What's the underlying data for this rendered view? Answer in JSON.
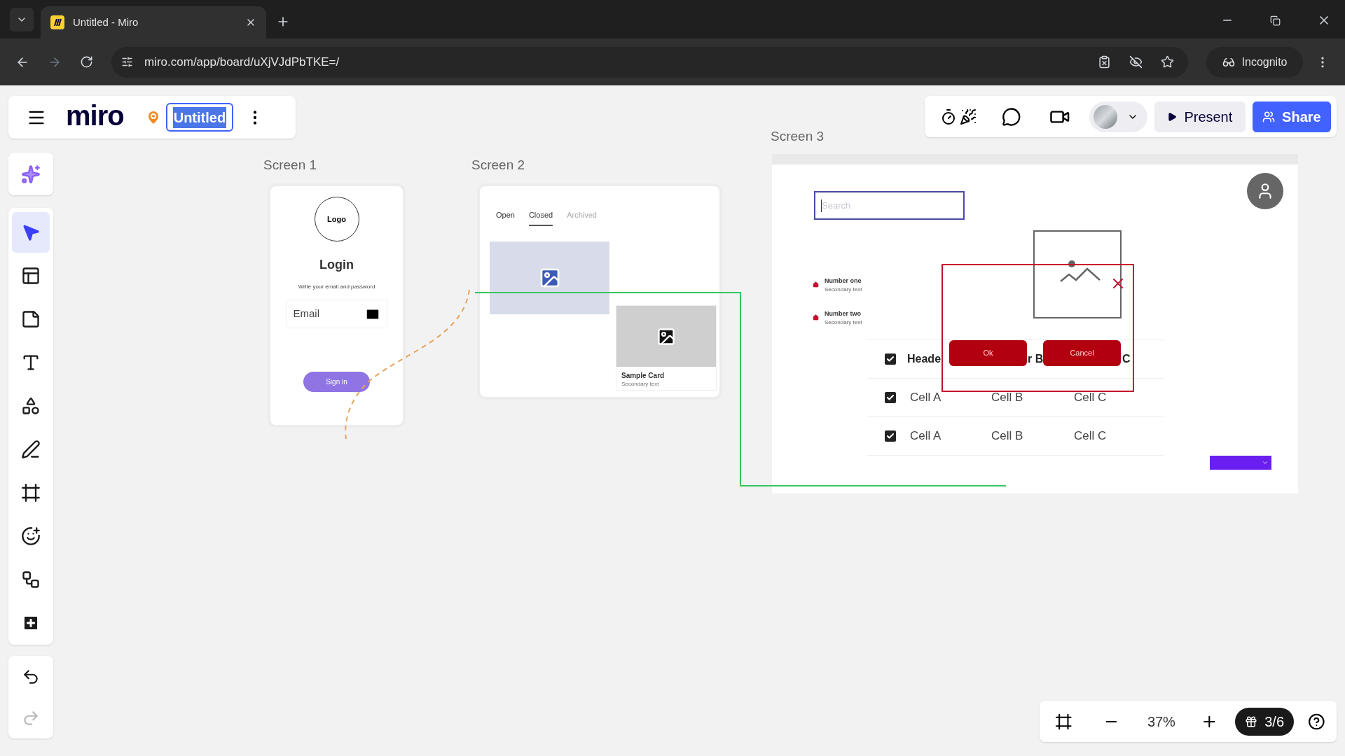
{
  "browser": {
    "tab": {
      "title": "Untitled - Miro",
      "selected": true
    },
    "url": "miro.com/app/board/uXjVJdPbTKE=/",
    "profile": "Incognito"
  },
  "board_header": {
    "logo": "miro",
    "title": "Untitled",
    "title_selected": true
  },
  "collab": {
    "present": "Present",
    "share": "Share"
  },
  "tools": [
    {
      "kind": "select",
      "selected": true
    },
    {
      "kind": "templates",
      "selected": false
    },
    {
      "kind": "sticky",
      "selected": false
    },
    {
      "kind": "text",
      "selected": false
    },
    {
      "kind": "shapes",
      "selected": false
    },
    {
      "kind": "pen",
      "selected": false
    },
    {
      "kind": "frame",
      "selected": false
    },
    {
      "kind": "sticker",
      "selected": false
    },
    {
      "kind": "diagram",
      "selected": false
    },
    {
      "kind": "add",
      "selected": false
    }
  ],
  "history": [
    {
      "kind": "undo",
      "disabled": false
    },
    {
      "kind": "redo",
      "disabled": true
    }
  ],
  "zoom_bar": {
    "zoom": "37%",
    "gift_count": "3/6"
  },
  "screen_1": {
    "label": "Screen 1",
    "logo": "Logo",
    "heading": "Login",
    "subtitle": "Write your email and password",
    "email_field": "Email",
    "button": "Sign in"
  },
  "screen_2": {
    "label": "Screen 2",
    "tabs": [
      {
        "label": "Open",
        "selected": false,
        "disabled": false
      },
      {
        "label": "Closed",
        "selected": true,
        "disabled": false
      },
      {
        "label": "Archived",
        "selected": false,
        "disabled": true
      }
    ],
    "card": {
      "title": "Sample Card",
      "subtitle": "Secondary text"
    }
  },
  "screen_3": {
    "label": "Screen 3",
    "search": {
      "placeholder": "Search"
    },
    "list": [
      {
        "title": "Number one",
        "subtitle": "Secondary text"
      },
      {
        "title": "Number two",
        "subtitle": "Secondary text"
      }
    ],
    "dialog": {
      "buttons": [
        "Ok",
        "Cancel"
      ]
    },
    "table": {
      "header": [
        "Heade",
        "r B",
        "C"
      ],
      "header_checked": true,
      "rows": [
        {
          "checked": true,
          "cells": [
            "Cell A",
            "Cell B",
            "Cell C"
          ]
        },
        {
          "checked": true,
          "cells": [
            "Cell A",
            "Cell B",
            "Cell C"
          ]
        }
      ]
    }
  }
}
